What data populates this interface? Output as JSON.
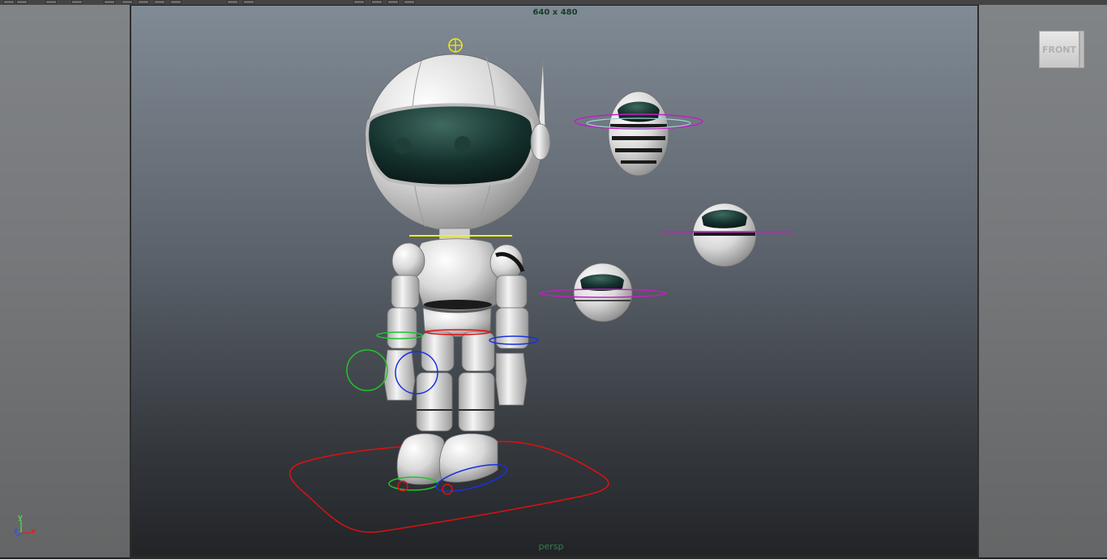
{
  "viewport": {
    "resolution_gate": "640 x 480",
    "camera_label": "persp"
  },
  "view_cube": {
    "face_label": "FRONT"
  },
  "axis_indicator": {
    "x_label": "x",
    "y_label": "y",
    "z_label": "z"
  },
  "colors": {
    "selection_handle": "#f4f000",
    "nurbs_curve_red": "#e01010",
    "nurbs_curve_green": "#22c32a",
    "nurbs_curve_blue": "#1830e0",
    "nurbs_curve_magenta": "#c020c0",
    "resolution_text": "#143c28",
    "camera_label": "#3d7a4f"
  },
  "scene": {
    "objects": [
      "robot-character",
      "floating-drone-segmented",
      "floating-drone-large",
      "floating-drone-small"
    ]
  }
}
